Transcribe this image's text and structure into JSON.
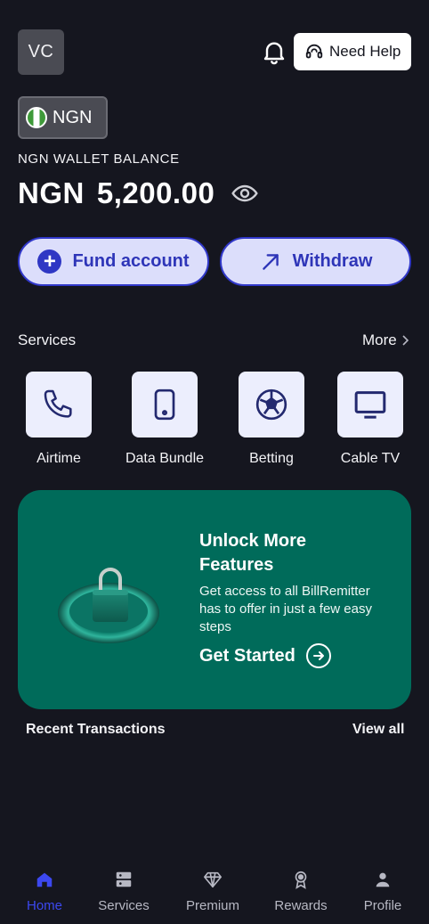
{
  "header": {
    "avatar_initials": "VC",
    "help_label": "Need Help"
  },
  "wallet": {
    "currency_code": "NGN",
    "balance_label": "NGN WALLET BALANCE",
    "balance_currency": "NGN",
    "balance_amount": "5,200.00"
  },
  "actions": {
    "fund_label": "Fund account",
    "withdraw_label": "Withdraw"
  },
  "services": {
    "title": "Services",
    "more_label": "More",
    "items": [
      {
        "label": "Airtime",
        "icon": "phone-icon"
      },
      {
        "label": "Data Bundle",
        "icon": "mobile-device-icon"
      },
      {
        "label": "Betting",
        "icon": "football-icon"
      },
      {
        "label": "Cable TV",
        "icon": "tv-icon"
      }
    ]
  },
  "promo": {
    "title": "Unlock More Features",
    "text": "Get access to all BillRemitter has to offer in just a few easy steps",
    "cta_label": "Get Started"
  },
  "transactions": {
    "title": "Recent Transactions",
    "view_all_label": "View all"
  },
  "nav": {
    "items": [
      {
        "label": "Home",
        "icon": "home-icon",
        "active": true
      },
      {
        "label": "Services",
        "icon": "services-icon",
        "active": false
      },
      {
        "label": "Premium",
        "icon": "diamond-icon",
        "active": false
      },
      {
        "label": "Rewards",
        "icon": "medal-icon",
        "active": false
      },
      {
        "label": "Profile",
        "icon": "person-icon",
        "active": false
      }
    ]
  },
  "colors": {
    "background": "#15161f",
    "accent": "#2f37c4",
    "button_fill": "#dcdefb",
    "promo_green": "#006b5a",
    "nav_active": "#3c48f0"
  }
}
